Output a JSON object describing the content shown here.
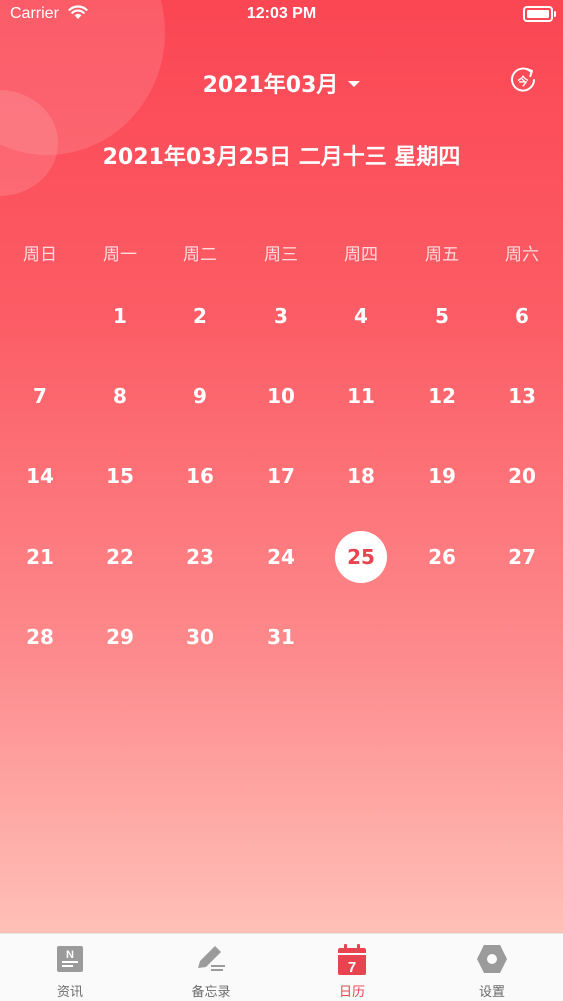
{
  "status_bar": {
    "carrier": "Carrier",
    "time": "12:03 PM"
  },
  "header": {
    "month": "2021年03月",
    "today_icon": "today-refresh-icon",
    "today_glyph": "今",
    "selected_date_full": "2021年03月25日 二月十三 星期四"
  },
  "calendar": {
    "weekdays": [
      "周日",
      "周一",
      "周二",
      "周三",
      "周四",
      "周五",
      "周六"
    ],
    "first_weekday_index": 1,
    "days": [
      "1",
      "2",
      "3",
      "4",
      "5",
      "6",
      "7",
      "8",
      "9",
      "10",
      "11",
      "12",
      "13",
      "14",
      "15",
      "16",
      "17",
      "18",
      "19",
      "20",
      "21",
      "22",
      "23",
      "24",
      "25",
      "26",
      "27",
      "28",
      "29",
      "30",
      "31"
    ],
    "selected_day": "25"
  },
  "tabbar": {
    "tabs": [
      {
        "label": "资讯",
        "icon": "news-icon",
        "active": false
      },
      {
        "label": "备忘录",
        "icon": "memo-pencil-icon",
        "active": false
      },
      {
        "label": "日历",
        "icon": "calendar-icon",
        "active": true,
        "icon_text": "7"
      },
      {
        "label": "设置",
        "icon": "settings-hexagon-icon",
        "active": false
      }
    ]
  },
  "colors": {
    "accent": "#e8444f",
    "inactive": "#6b6b6b",
    "top_gradient": "#fb4654",
    "bottom_gradient": "#ffc0b8"
  }
}
